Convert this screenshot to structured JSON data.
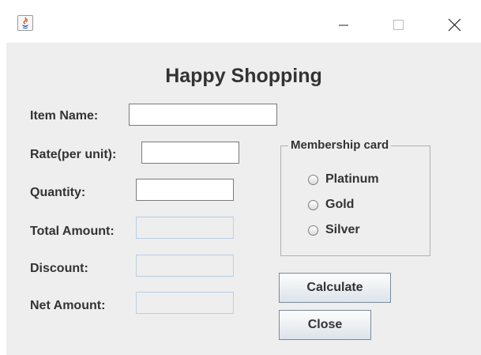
{
  "window": {
    "icon": "java-icon",
    "controls": [
      "minimize-icon",
      "maximize-icon",
      "close-icon"
    ]
  },
  "form": {
    "title": "Happy Shopping",
    "fields": {
      "item_name": {
        "label": "Item Name:",
        "value": ""
      },
      "rate": {
        "label": "Rate(per unit):",
        "value": ""
      },
      "quantity": {
        "label": "Quantity:",
        "value": ""
      },
      "total_amount": {
        "label": "Total Amount:",
        "value": ""
      },
      "discount": {
        "label": "Discount:",
        "value": ""
      },
      "net_amount": {
        "label": "Net Amount:",
        "value": ""
      }
    },
    "membership": {
      "title": "Membership card",
      "options": [
        "Platinum",
        "Gold",
        "Silver"
      ],
      "selected": null
    },
    "buttons": {
      "calculate": "Calculate",
      "close": "Close"
    }
  }
}
